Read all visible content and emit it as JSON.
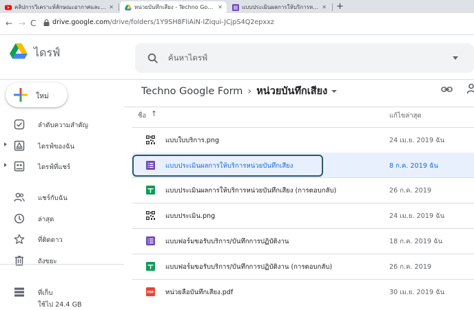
{
  "browser": {
    "tabs": [
      {
        "title": "คลิปการวิเคราะห์ลักษณะอากาศและคลิ",
        "close": "✕"
      },
      {
        "title": "หน่วยบันทึกเสียง - Techno Google F",
        "close": "✕"
      },
      {
        "title": "แบบประเมินผลการให้บริการหน่วยบันทึ",
        "close": "✕"
      }
    ],
    "new_tab": "+",
    "url_host": "drive.google.com",
    "url_path": "/drive/folders/1Y9SH8FliAiN-IZiqui-JCjpS4Q2epxxz",
    "nav": {
      "back": "←",
      "forward": "→",
      "reload": "C"
    }
  },
  "drive": {
    "brand": "ไดรฟ์",
    "search_placeholder": "ค้นหาไดรฟ์"
  },
  "sidebar": {
    "new_label": "ใหม่",
    "items": [
      {
        "label": "ลำดับความสำคัญ",
        "icon": "priority-icon"
      },
      {
        "label": "ไดรฟ์ของฉัน",
        "icon": "my-drive-icon"
      },
      {
        "label": "ไดรฟ์ที่แชร์",
        "icon": "shared-drives-icon"
      },
      {
        "label": "แชร์กับฉัน",
        "icon": "shared-with-me-icon"
      },
      {
        "label": "ล่าสุด",
        "icon": "clock-icon"
      },
      {
        "label": "ที่ติดดาว",
        "icon": "star-icon"
      },
      {
        "label": "ถังขยะ",
        "icon": "trash-icon"
      },
      {
        "label": "ที่เก็บ",
        "icon": "storage-icon"
      }
    ],
    "storage_used": "ใช้ไป 24.4 GB"
  },
  "main": {
    "breadcrumb": {
      "parent": "Techno Google Form",
      "separator": "›",
      "current": "หน่วยบันทึกเสียง"
    },
    "columns": {
      "name": "ชื่อ",
      "sort_arrow": "↑",
      "modified": "แก้ไขล่าสุด"
    },
    "files": [
      {
        "name": "แบบใบบริการ.png",
        "modified": "24 เม.ย. 2019 ฉัน",
        "type": "image",
        "icon": "qr-image-icon"
      },
      {
        "name": "แบบประเมินผลการให้บริการหน่วยบันทึกเสียง",
        "modified": "8 ก.ค. 2019 ฉัน",
        "type": "form",
        "icon": "google-forms-icon"
      },
      {
        "name": "แบบประเมินผลการให้บริการหน่วยบันทึกเสียง (การตอบกลับ)",
        "modified": "26 ก.ค. 2019",
        "type": "sheet",
        "icon": "google-sheets-icon"
      },
      {
        "name": "แบบประเมิน.png",
        "modified": "24 เม.ย. 2019 ฉัน",
        "type": "image",
        "icon": "qr-image-icon"
      },
      {
        "name": "แบบฟอร์มขอรับบริการ/บันทึกการปฏิบัติงาน",
        "modified": "18 ก.ค. 2019 ฉัน",
        "type": "form",
        "icon": "google-forms-icon"
      },
      {
        "name": "แบบฟอร์มขอรับบริการ/บันทึกการปฏิบัติงาน (การตอบกลับ)",
        "modified": "26 ก.ค. 2019",
        "type": "sheet",
        "icon": "google-sheets-icon"
      },
      {
        "name": "หน่วยลือบันทึกเสียง.pdf",
        "modified": "30 เม.ย. 2019 ฉัน",
        "type": "pdf",
        "icon": "pdf-icon"
      }
    ]
  },
  "colors": {
    "forms": "#7248b9",
    "sheets": "#0f9d58",
    "pdf": "#ea4335",
    "accent": "#1967d2",
    "highlight_border": "#2e5573"
  }
}
